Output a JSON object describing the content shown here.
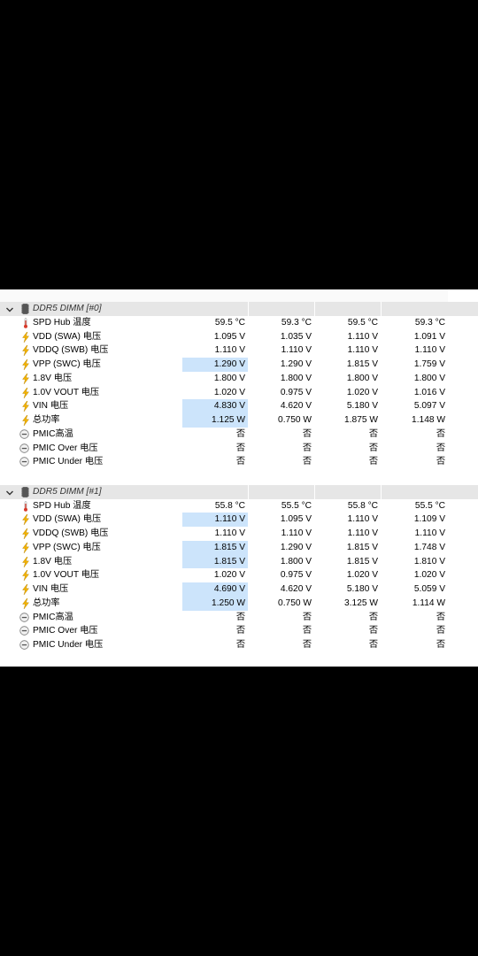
{
  "groups": [
    {
      "title": "DDR5 DIMM [#0]",
      "rows": [
        {
          "label": "SPD Hub 温度",
          "icon": "thermometer-icon",
          "values": [
            "59.5 °C",
            "59.3 °C",
            "59.5 °C",
            "59.3 °C"
          ],
          "hl": [
            false,
            false,
            false,
            false
          ]
        },
        {
          "label": "VDD (SWA) 电压",
          "icon": "lightning-icon",
          "values": [
            "1.095 V",
            "1.035 V",
            "1.110 V",
            "1.091 V"
          ],
          "hl": [
            false,
            false,
            false,
            false
          ]
        },
        {
          "label": "VDDQ (SWB) 电压",
          "icon": "lightning-icon",
          "values": [
            "1.110 V",
            "1.110 V",
            "1.110 V",
            "1.110 V"
          ],
          "hl": [
            false,
            false,
            false,
            false
          ]
        },
        {
          "label": "VPP (SWC) 电压",
          "icon": "lightning-icon",
          "values": [
            "1.290 V",
            "1.290 V",
            "1.815 V",
            "1.759 V"
          ],
          "hl": [
            true,
            false,
            false,
            false
          ]
        },
        {
          "label": "1.8V 电压",
          "icon": "lightning-icon",
          "values": [
            "1.800 V",
            "1.800 V",
            "1.800 V",
            "1.800 V"
          ],
          "hl": [
            false,
            false,
            false,
            false
          ]
        },
        {
          "label": "1.0V VOUT 电压",
          "icon": "lightning-icon",
          "values": [
            "1.020 V",
            "0.975 V",
            "1.020 V",
            "1.016 V"
          ],
          "hl": [
            false,
            false,
            false,
            false
          ]
        },
        {
          "label": "VIN 电压",
          "icon": "lightning-icon",
          "values": [
            "4.830 V",
            "4.620 V",
            "5.180 V",
            "5.097 V"
          ],
          "hl": [
            true,
            false,
            false,
            false
          ]
        },
        {
          "label": "总功率",
          "icon": "lightning-icon",
          "values": [
            "1.125 W",
            "0.750 W",
            "1.875 W",
            "1.148 W"
          ],
          "hl": [
            true,
            false,
            false,
            false
          ]
        },
        {
          "label": "PMIC高温",
          "icon": "minus-circle-icon",
          "values": [
            "否",
            "否",
            "否",
            "否"
          ],
          "hl": [
            false,
            false,
            false,
            false
          ]
        },
        {
          "label": "PMIC Over 电压",
          "icon": "minus-circle-icon",
          "values": [
            "否",
            "否",
            "否",
            "否"
          ],
          "hl": [
            false,
            false,
            false,
            false
          ]
        },
        {
          "label": "PMIC Under 电压",
          "icon": "minus-circle-icon",
          "values": [
            "否",
            "否",
            "否",
            "否"
          ],
          "hl": [
            false,
            false,
            false,
            false
          ]
        }
      ]
    },
    {
      "title": "DDR5 DIMM [#1]",
      "rows": [
        {
          "label": "SPD Hub 温度",
          "icon": "thermometer-icon",
          "values": [
            "55.8 °C",
            "55.5 °C",
            "55.8 °C",
            "55.5 °C"
          ],
          "hl": [
            false,
            false,
            false,
            false
          ]
        },
        {
          "label": "VDD (SWA) 电压",
          "icon": "lightning-icon",
          "values": [
            "1.110 V",
            "1.095 V",
            "1.110 V",
            "1.109 V"
          ],
          "hl": [
            true,
            false,
            false,
            false
          ]
        },
        {
          "label": "VDDQ (SWB) 电压",
          "icon": "lightning-icon",
          "values": [
            "1.110 V",
            "1.110 V",
            "1.110 V",
            "1.110 V"
          ],
          "hl": [
            false,
            false,
            false,
            false
          ]
        },
        {
          "label": "VPP (SWC) 电压",
          "icon": "lightning-icon",
          "values": [
            "1.815 V",
            "1.290 V",
            "1.815 V",
            "1.748 V"
          ],
          "hl": [
            true,
            false,
            false,
            false
          ]
        },
        {
          "label": "1.8V 电压",
          "icon": "lightning-icon",
          "values": [
            "1.815 V",
            "1.800 V",
            "1.815 V",
            "1.810 V"
          ],
          "hl": [
            true,
            false,
            false,
            false
          ]
        },
        {
          "label": "1.0V VOUT 电压",
          "icon": "lightning-icon",
          "values": [
            "1.020 V",
            "0.975 V",
            "1.020 V",
            "1.020 V"
          ],
          "hl": [
            false,
            false,
            false,
            false
          ]
        },
        {
          "label": "VIN 电压",
          "icon": "lightning-icon",
          "values": [
            "4.690 V",
            "4.620 V",
            "5.180 V",
            "5.059 V"
          ],
          "hl": [
            true,
            false,
            false,
            false
          ]
        },
        {
          "label": "总功率",
          "icon": "lightning-icon",
          "values": [
            "1.250 W",
            "0.750 W",
            "3.125 W",
            "1.114 W"
          ],
          "hl": [
            true,
            false,
            false,
            false
          ]
        },
        {
          "label": "PMIC高温",
          "icon": "minus-circle-icon",
          "values": [
            "否",
            "否",
            "否",
            "否"
          ],
          "hl": [
            false,
            false,
            false,
            false
          ]
        },
        {
          "label": "PMIC Over 电压",
          "icon": "minus-circle-icon",
          "values": [
            "否",
            "否",
            "否",
            "否"
          ],
          "hl": [
            false,
            false,
            false,
            false
          ]
        },
        {
          "label": "PMIC Under 电压",
          "icon": "minus-circle-icon",
          "values": [
            "否",
            "否",
            "否",
            "否"
          ],
          "hl": [
            false,
            false,
            false,
            false
          ]
        }
      ]
    }
  ],
  "colors": {
    "highlight": "#cce4fb",
    "header_bg": "#e6e6e6",
    "lightning": "#f5b400",
    "thermometer": "#d83a2a"
  }
}
